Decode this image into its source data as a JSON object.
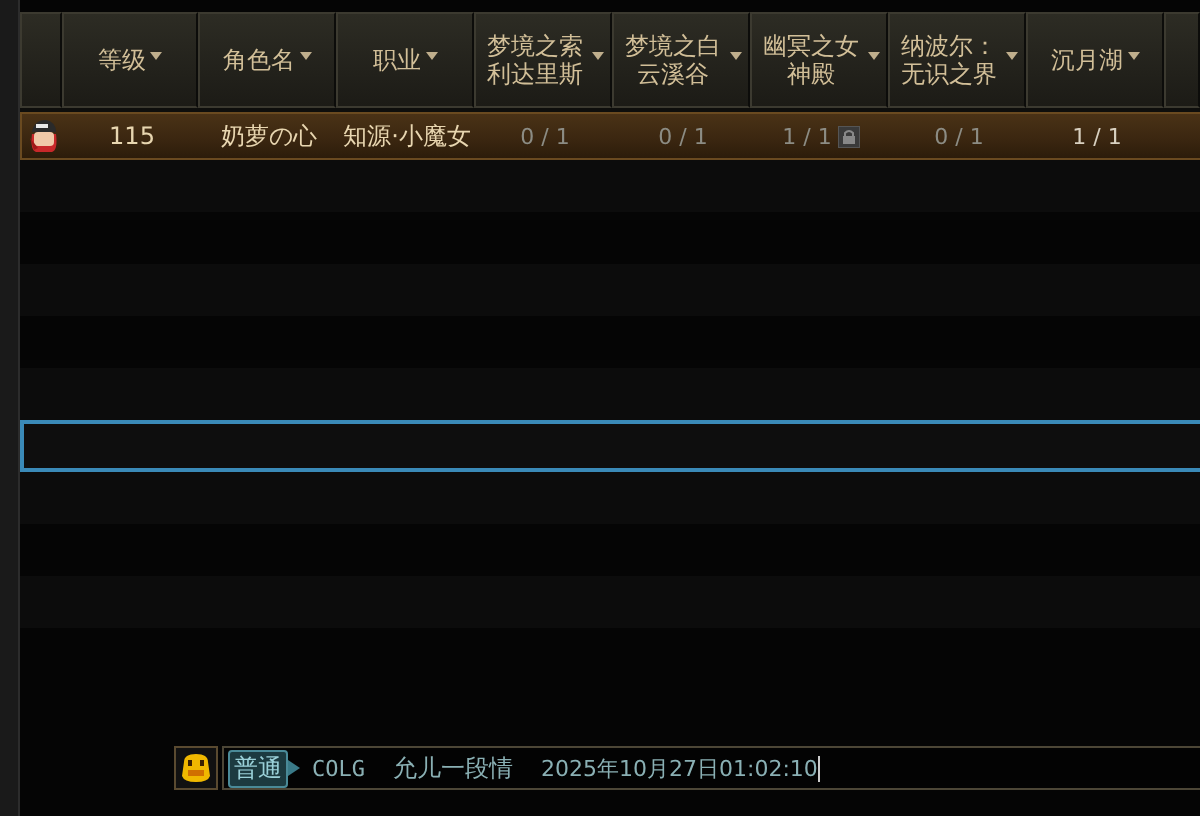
{
  "table": {
    "columns": [
      {
        "kind": "blank"
      },
      {
        "kind": "sort",
        "label": "等级"
      },
      {
        "kind": "sort",
        "label": "角色名"
      },
      {
        "kind": "sort",
        "label": "职业"
      },
      {
        "kind": "sort",
        "label": "梦境之索利达里斯"
      },
      {
        "kind": "sort",
        "label": "梦境之白云溪谷"
      },
      {
        "kind": "sort",
        "label": "幽冥之女神殿"
      },
      {
        "kind": "sort",
        "label": "纳波尔：无识之界"
      },
      {
        "kind": "sort",
        "label": "沉月湖"
      },
      {
        "kind": "blank"
      }
    ],
    "rows": [
      {
        "selected": true,
        "focused": false,
        "cells": [
          {
            "kind": "avatar"
          },
          {
            "kind": "text",
            "text": "115"
          },
          {
            "kind": "text",
            "text": "奶萝の心"
          },
          {
            "kind": "text",
            "text": "知源·小魔女"
          },
          {
            "kind": "progress",
            "text": "0 / 1",
            "complete": false,
            "locked": false
          },
          {
            "kind": "progress",
            "text": "0 / 1",
            "complete": false,
            "locked": false
          },
          {
            "kind": "progress",
            "text": "1 / 1",
            "complete": false,
            "locked": true
          },
          {
            "kind": "progress",
            "text": "0 / 1",
            "complete": false,
            "locked": false
          },
          {
            "kind": "progress",
            "text": "1 / 1",
            "complete": true,
            "locked": false
          }
        ]
      },
      {
        "selected": false,
        "focused": false
      },
      {
        "selected": false,
        "focused": false
      },
      {
        "selected": false,
        "focused": false
      },
      {
        "selected": false,
        "focused": false
      },
      {
        "selected": false,
        "focused": false
      },
      {
        "selected": false,
        "focused": true
      },
      {
        "selected": false,
        "focused": false
      },
      {
        "selected": false,
        "focused": false
      },
      {
        "selected": false,
        "focused": false
      },
      {
        "selected": false,
        "focused": false
      }
    ]
  },
  "chat_input": {
    "channel": "普通",
    "parts": [
      "COLG",
      "允儿一段情",
      "2025年10月27日01:02:10"
    ]
  }
}
